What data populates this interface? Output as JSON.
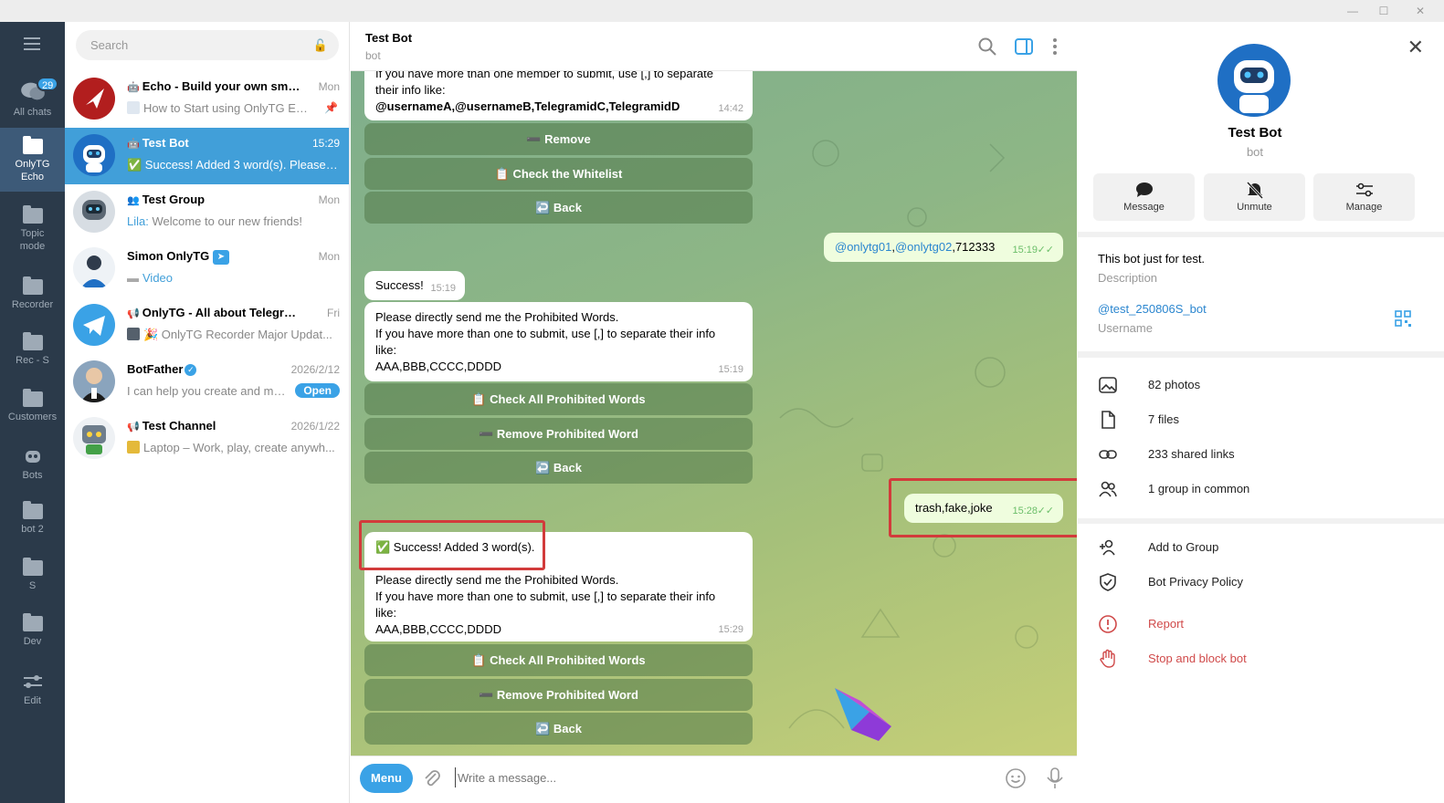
{
  "window": {
    "minimize": "—",
    "maximize": "☐",
    "close": "✕"
  },
  "rail": {
    "all_chats": {
      "label": "All chats",
      "badge": "29"
    },
    "folders": [
      {
        "label": "OnlyTG Echo",
        "active": true
      },
      {
        "label": "Topic mode"
      },
      {
        "label": "Recorder"
      },
      {
        "label": "Rec - S"
      },
      {
        "label": "Customers"
      },
      {
        "label": "Bots"
      },
      {
        "label": "bot 2"
      },
      {
        "label": "S"
      },
      {
        "label": "Dev"
      },
      {
        "label": "Edit"
      }
    ]
  },
  "search": {
    "placeholder": "Search"
  },
  "chats": [
    {
      "title": "Echo - Build your own smar...",
      "time": "Mon",
      "preview": "How to Start using OnlyTG Ec..."
    },
    {
      "title": "Test Bot",
      "time": "15:29",
      "preview": "✅ Success! Added 3 word(s).  Please ..."
    },
    {
      "title": "Test Group",
      "time": "Mon",
      "sender": "Lila:",
      "preview": " Welcome to our new friends!"
    },
    {
      "title": "Simon OnlyTG",
      "time": "Mon",
      "preview": "Video"
    },
    {
      "title": "OnlyTG - All about Telegram",
      "time": "Fri",
      "preview": "🎉 OnlyTG Recorder Major Updat..."
    },
    {
      "title": "BotFather",
      "time": "2026/2/12",
      "preview": "I can help you create and ma...",
      "button": "Open"
    },
    {
      "title": "Test Channel",
      "time": "2026/1/22",
      "preview": "Laptop – Work, play, create anywh..."
    }
  ],
  "header": {
    "title": "Test Bot",
    "subtitle": "bot"
  },
  "messages": {
    "m1_line1": "If you have more than one member to submit, use [,] to separate",
    "m1_line2": "their info like:",
    "m1_line3": "@usernameA,@usernameB,TelegramidC,TelegramidD",
    "m1_time": "14:42",
    "kb1": [
      "➖ Remove",
      "📋 Check the Whitelist",
      "↩️ Back"
    ],
    "out1_link1": "@onlytg01",
    "out1_comma": ",",
    "out1_link2": "@onlytg02",
    "out1_rest": ",712333",
    "out1_time": "15:19",
    "m2_text": "Success!",
    "m2_time": "15:19",
    "m3_line1": "Please directly send me the Prohibited Words.",
    "m3_line2": "If you have more than one to submit, use [,] to separate their info",
    "m3_line3": "like:",
    "m3_line4": "AAA,BBB,CCCC,DDDD",
    "m3_time": "15:19",
    "kb2": [
      "📋 Check All Prohibited Words",
      "➖ Remove Prohibited Word",
      "↩️ Back"
    ],
    "out2_text": "trash,fake,joke",
    "out2_time": "15:28",
    "m4_line0": "✅ Success! Added 3 word(s).",
    "m4_line1": "Please directly send me the Prohibited Words.",
    "m4_line2": "If you have more than one to submit, use [,] to separate their info",
    "m4_line3": "like:",
    "m4_line4": "AAA,BBB,CCCC,DDDD",
    "m4_time": "15:29",
    "kb3": [
      "📋 Check All Prohibited Words",
      "➖ Remove Prohibited Word",
      "↩️ Back"
    ]
  },
  "composer": {
    "menu": "Menu",
    "placeholder": "Write a message..."
  },
  "profile": {
    "name": "Test Bot",
    "subtitle": "bot",
    "actions": [
      "Message",
      "Unmute",
      "Manage"
    ],
    "description": "This bot just for test.",
    "description_label": "Description",
    "username": "@test_250806S_bot",
    "username_label": "Username",
    "media": [
      "82 photos",
      "7 files",
      "233 shared links",
      "1 group in common"
    ],
    "actions_list": [
      "Add to Group",
      "Bot Privacy Policy"
    ],
    "danger": [
      "Report",
      "Stop and block bot"
    ]
  },
  "colors": {
    "accent": "#3aa2e6",
    "rail_bg": "#2b3a4a",
    "active_row": "#419fd9",
    "danger": "#d04a4a",
    "highlight": "#d23b3b"
  }
}
